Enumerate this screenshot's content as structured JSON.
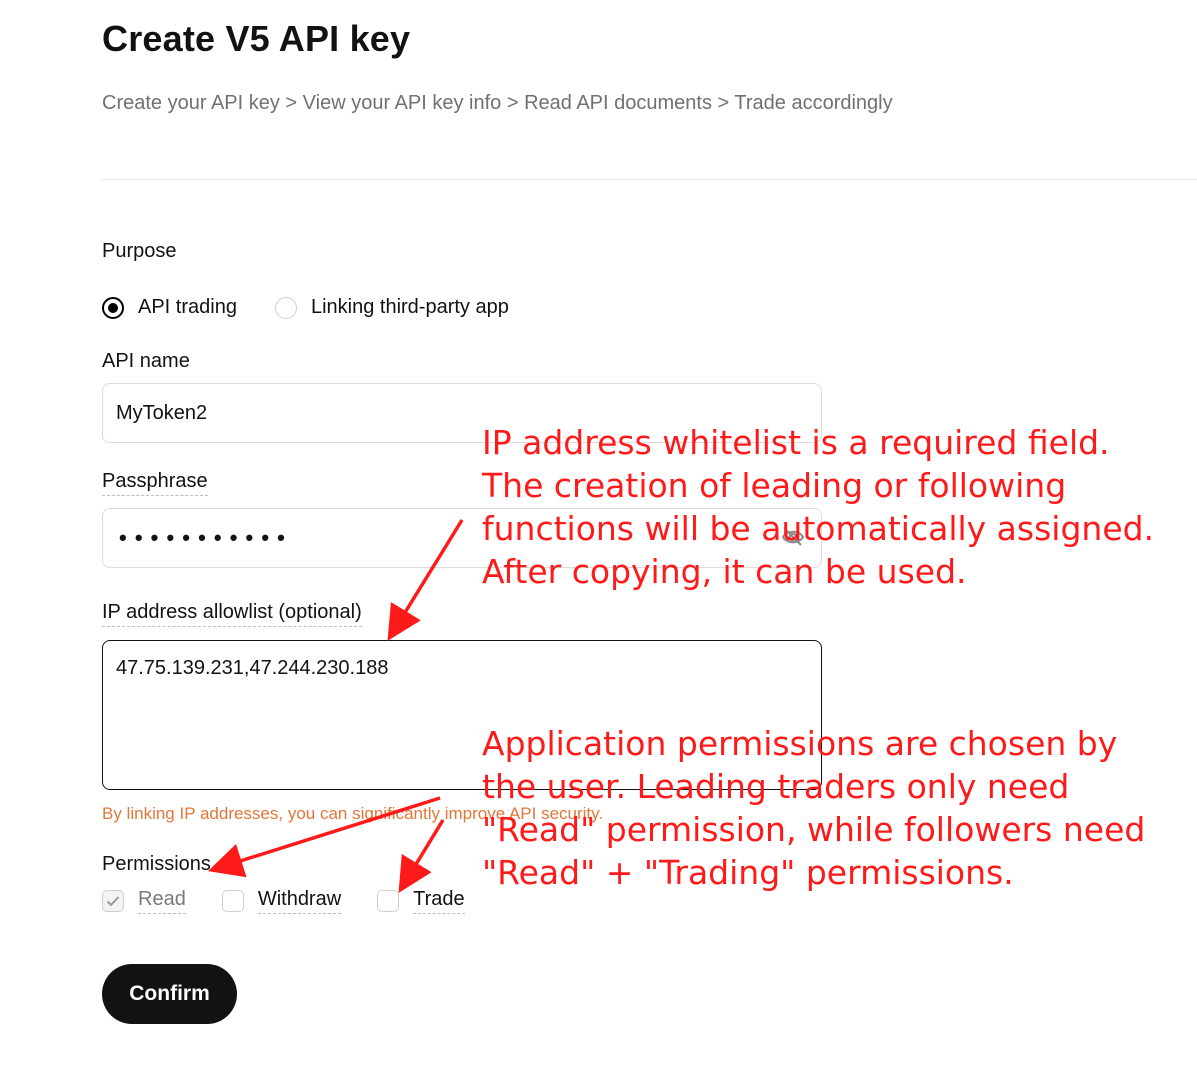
{
  "page": {
    "title": "Create V5 API key",
    "breadcrumb": "Create your API key > View your API key info > Read API documents > Trade accordingly"
  },
  "form": {
    "purpose_label": "Purpose",
    "purpose_options": [
      "API trading",
      "Linking third-party app"
    ],
    "purpose_selected": "API trading",
    "api_name_label": "API name",
    "api_name_value": "MyToken2",
    "passphrase_label": "Passphrase",
    "passphrase_value": "• • • • • • • • • • •",
    "ip_label": "IP address allowlist (optional)",
    "ip_value": "47.75.139.231,47.244.230.188",
    "ip_helper": "By linking IP addresses, you can significantly improve API security.",
    "permissions_label": "Permissions",
    "permissions": [
      {
        "label": "Read",
        "checked": true,
        "disabled": true
      },
      {
        "label": "Withdraw",
        "checked": false
      },
      {
        "label": "Trade",
        "checked": false
      }
    ],
    "confirm_label": "Confirm"
  },
  "annotations": {
    "note_ip": "IP address whitelist is a required field. The creation of leading or following functions will be automatically assigned. After copying, it can be used.",
    "note_permissions": "Application permissions are chosen by the user. Leading traders only need \"Read\" permission, while followers need \"Read\" + \"Trading\" permissions.",
    "color": "#ff1a1a"
  },
  "icons": {
    "eye_hidden": "eye-off-icon",
    "checkmark": "check-icon"
  }
}
